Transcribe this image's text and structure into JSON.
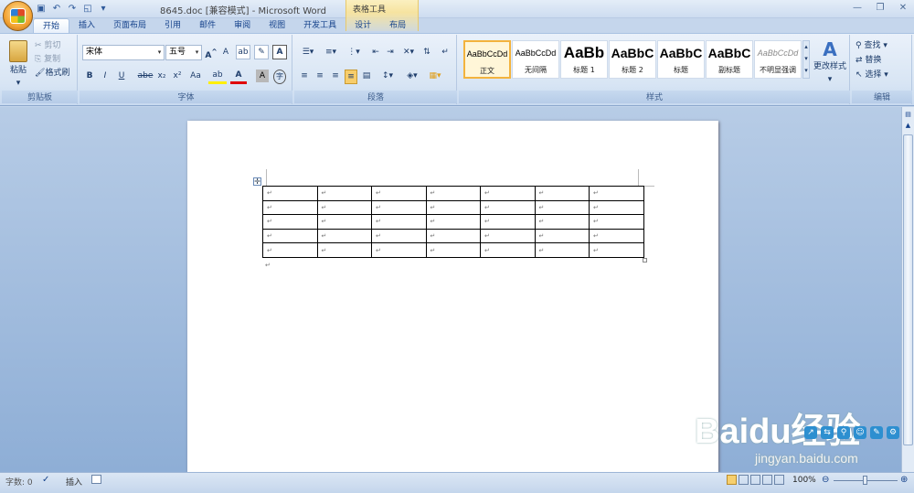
{
  "app": {
    "window_title": "8645.doc [兼容模式] - Microsoft Word",
    "context_tools_label": "表格工具",
    "tabs": [
      "开始",
      "插入",
      "页面布局",
      "引用",
      "邮件",
      "审阅",
      "视图",
      "开发工具",
      "设计",
      "布局"
    ],
    "qat_icons": [
      "save-icon",
      "undo-icon",
      "redo-icon",
      "print-preview-icon",
      "customize-icon"
    ]
  },
  "ribbon": {
    "clipboard": {
      "paste": "粘贴",
      "cut": "剪切",
      "copy": "复制",
      "format_painter": "格式刷",
      "label": "剪贴板"
    },
    "font": {
      "font_name": "宋体",
      "font_size": "五号",
      "label": "字体",
      "bold": "B",
      "italic": "I",
      "underline": "U",
      "strike": "abe",
      "sub": "x₂",
      "sup": "x²",
      "case": "Aa",
      "grow": "A",
      "shrink": "A"
    },
    "paragraph": {
      "label": "段落"
    },
    "styles": {
      "label": "样式",
      "tiles": [
        {
          "sample": "AaBbCcDd",
          "name": "正文"
        },
        {
          "sample": "AaBbCcDd",
          "name": "无间隔"
        },
        {
          "sample": "AaBb",
          "name": "标题 1"
        },
        {
          "sample": "AaBbC",
          "name": "标题 2"
        },
        {
          "sample": "AaBbC",
          "name": "标题"
        },
        {
          "sample": "AaBbC",
          "name": "副标题"
        },
        {
          "sample": "AaBbCcDd",
          "name": "不明显强调"
        }
      ],
      "change_styles": "更改样式"
    },
    "editing": {
      "find": "查找",
      "replace": "替换",
      "select": "选择",
      "label": "编辑"
    }
  },
  "document": {
    "table": {
      "rows": 5,
      "cols": 7,
      "cell_mark": "↵"
    },
    "after_table_mark": "↵"
  },
  "status": {
    "word_count": "字数: 0",
    "mode": "插入",
    "zoom": "100%"
  },
  "watermark": {
    "brand": "Baidu经验",
    "url": "jingyan.baidu.com"
  }
}
